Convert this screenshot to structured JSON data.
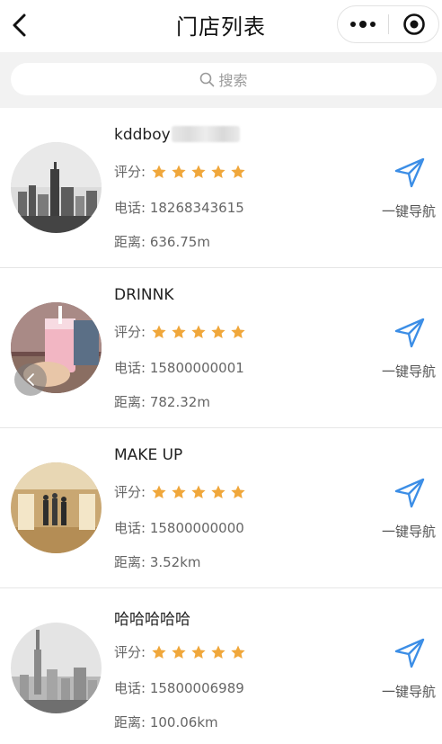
{
  "header": {
    "title": "门店列表"
  },
  "search": {
    "placeholder": "搜索"
  },
  "labels": {
    "rating": "评分:",
    "phone_prefix": "电话: ",
    "distance_prefix": "距离: ",
    "nav": "一键导航"
  },
  "colors": {
    "star": "#f0a73b",
    "nav_icon": "#3c8ee6"
  },
  "stores": [
    {
      "name": "kddboy",
      "stars": 5,
      "phone": "18268343615",
      "distance": "636.75m",
      "image": "city-skyline-bw"
    },
    {
      "name": "DRINNK",
      "stars": 5,
      "phone": "15800000001",
      "distance": "782.32m",
      "image": "bubble-tea-drink"
    },
    {
      "name": "MAKE UP",
      "stars": 5,
      "phone": "15800000000",
      "distance": "3.52km",
      "image": "store-interior"
    },
    {
      "name": "哈哈哈哈哈",
      "stars": 5,
      "phone": "15800006989",
      "distance": "100.06km",
      "image": "city-skyline-fog"
    }
  ]
}
